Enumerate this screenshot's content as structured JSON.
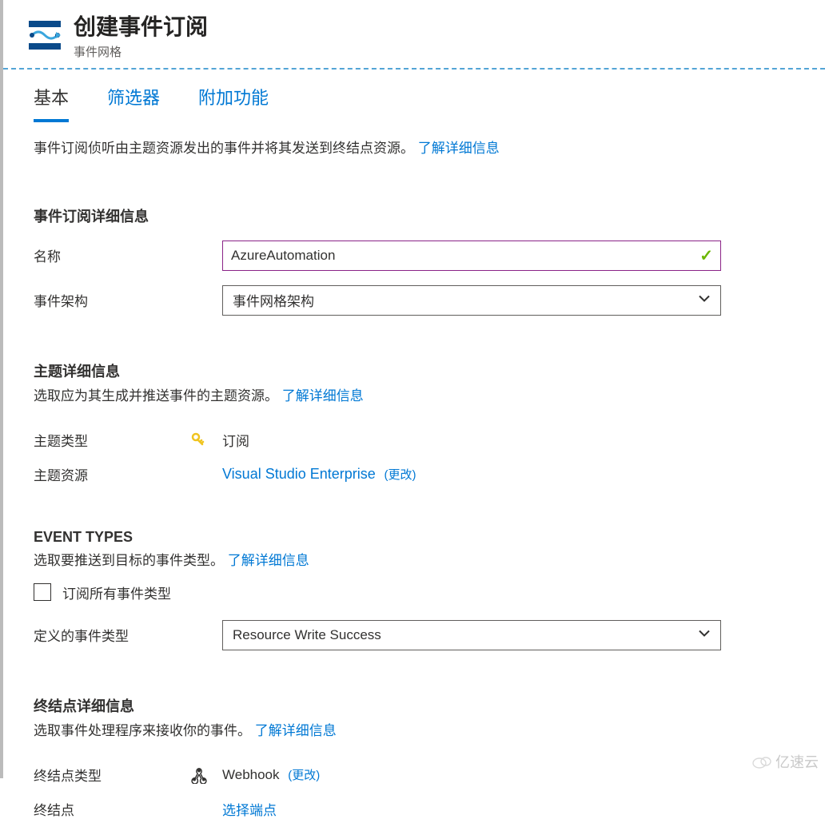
{
  "header": {
    "title": "创建事件订阅",
    "subtitle": "事件网格"
  },
  "tabs": {
    "t0": "基本",
    "t1": "筛选器",
    "t2": "附加功能"
  },
  "intro": {
    "text": "事件订阅侦听由主题资源发出的事件并将其发送到终结点资源。",
    "link": "了解详细信息"
  },
  "section1": {
    "title": "事件订阅详细信息",
    "name_label": "名称",
    "name_value": "AzureAutomation",
    "schema_label": "事件架构",
    "schema_value": "事件网格架构"
  },
  "section2": {
    "title": "主题详细信息",
    "desc": "选取应为其生成并推送事件的主题资源。",
    "desc_link": "了解详细信息",
    "type_label": "主题类型",
    "type_value": "订阅",
    "resource_label": "主题资源",
    "resource_value": "Visual Studio Enterprise",
    "change": "(更改)"
  },
  "section3": {
    "title": "EVENT TYPES",
    "desc": "选取要推送到目标的事件类型。",
    "desc_link": "了解详细信息",
    "checkbox_label": "订阅所有事件类型",
    "defined_label": "定义的事件类型",
    "defined_value": "Resource Write Success"
  },
  "section4": {
    "title": "终结点详细信息",
    "desc": "选取事件处理程序来接收你的事件。",
    "desc_link": "了解详细信息",
    "type_label": "终结点类型",
    "type_value": "Webhook",
    "change": "(更改)",
    "endpoint_label": "终结点",
    "endpoint_value": "选择端点"
  },
  "watermark": "亿速云"
}
